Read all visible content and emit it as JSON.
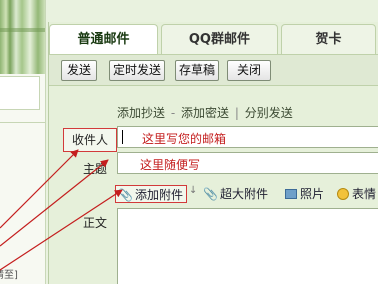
{
  "tabs": [
    {
      "label": "普通邮件",
      "active": true
    },
    {
      "label": "QQ群邮件",
      "active": false
    },
    {
      "label": "贺卡",
      "active": false
    }
  ],
  "toolbar": {
    "send": "发送",
    "timed_send": "定时发送",
    "save_draft": "存草稿",
    "close": "关闭"
  },
  "links": {
    "add_cc": "添加抄送",
    "sep1": "-",
    "add_bcc": "添加密送",
    "sep2": "|",
    "separate_send": "分别发送"
  },
  "fields": {
    "recipient_label": "收件人",
    "recipient_hint": "这里写您的邮箱",
    "subject_label": "主题",
    "subject_hint": "这里随便写",
    "body_label": "正文"
  },
  "attachments": {
    "add_attachment": "添加附件",
    "dropdown_arrow": "↓",
    "large_attachment": "超大附件",
    "photo": "照片",
    "emoji": "表情"
  },
  "left_panel": {
    "bottom_text": "请至]"
  },
  "colors": {
    "annotation_red": "#c41e1e",
    "panel_green": "#e6f0da"
  },
  "icons": [
    "paperclip-icon",
    "large-paperclip-icon",
    "photo-icon",
    "emoji-icon"
  ]
}
